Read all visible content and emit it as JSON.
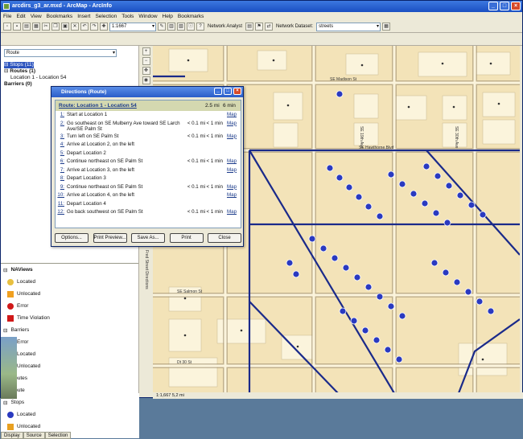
{
  "window": {
    "title": "arcdirs_g3_ar.mxd - ArcMap - ArcInfo"
  },
  "menu": [
    "File",
    "Edit",
    "View",
    "Bookmarks",
    "Insert",
    "Selection",
    "Tools",
    "Window",
    "Help",
    "Bookmarks"
  ],
  "toolbar": {
    "scale": "1:1667",
    "network_analyst_label": "Network Analyst",
    "network_dataset_label": "Network Dataset:",
    "network_dataset_value": "streets"
  },
  "na_layer": {
    "value": "Route"
  },
  "tree": [
    "Stops (11)",
    "Routes (1)",
    "Location 1 - Location 54",
    "Barriers (0)"
  ],
  "toc": {
    "group": "NAViews",
    "items": [
      "Located",
      "Unlocated",
      "Error",
      "Time Violation",
      "Barriers",
      "Error",
      "Located",
      "Unlocated",
      "Routes",
      "Route",
      "Stops",
      "Located",
      "Unlocated"
    ]
  },
  "tabs": [
    "Display",
    "Source",
    "Selection"
  ],
  "map_labels": [
    "SE Madison St",
    "SE Hawthorne Blvd",
    "SE Salmon St",
    "SE 19th Ave",
    "SE 30th Ave",
    "SE Main St",
    "Dt 30 St",
    "Fred Street Directions"
  ],
  "directions": {
    "title": "Directions (Route)",
    "header": {
      "title": "Route: Location 1 - Location 54",
      "distance": "2.5 mi",
      "time": "6 min"
    },
    "steps": [
      {
        "n": "1:",
        "text": "Start at Location 1",
        "dist": "",
        "time": "",
        "map": "Map"
      },
      {
        "n": "2:",
        "text": "Go southeast on SE Mulberry Ave toward SE Larch Ave/SE Palm St",
        "dist": "< 0.1 mi",
        "time": "< 1 min",
        "map": "Map"
      },
      {
        "n": "3:",
        "text": "Turn left on SE Palm St",
        "dist": "< 0.1 mi",
        "time": "< 1 min",
        "map": "Map"
      },
      {
        "n": "4:",
        "text": "Arrive at Location 2, on the left",
        "dist": "",
        "time": "",
        "map": ""
      },
      {
        "n": "5:",
        "text": "Depart Location 2",
        "dist": "",
        "time": "",
        "map": ""
      },
      {
        "n": "6:",
        "text": "Continue northeast on SE Palm St",
        "dist": "< 0.1 mi",
        "time": "< 1 min",
        "map": "Map"
      },
      {
        "n": "7:",
        "text": "Arrive at Location 3, on the left",
        "dist": "",
        "time": "",
        "map": "Map"
      },
      {
        "n": "8:",
        "text": "Depart Location 3",
        "dist": "",
        "time": "",
        "map": ""
      },
      {
        "n": "9:",
        "text": "Continue northeast on SE Palm St",
        "dist": "< 0.1 mi",
        "time": "< 1 min",
        "map": "Map"
      },
      {
        "n": "10:",
        "text": "Arrive at Location 4, on the left",
        "dist": "",
        "time": "",
        "map": "Map"
      },
      {
        "n": "11:",
        "text": "Depart Location 4",
        "dist": "",
        "time": "",
        "map": ""
      },
      {
        "n": "12:",
        "text": "Go back southwest on SE Palm St",
        "dist": "< 0.1 mi",
        "time": "< 1 min",
        "map": "Map"
      }
    ],
    "buttons": [
      "Options...",
      "Print Preview...",
      "Save As...",
      "Print",
      "Close"
    ]
  },
  "status": "1:1,667 5,2 mi"
}
